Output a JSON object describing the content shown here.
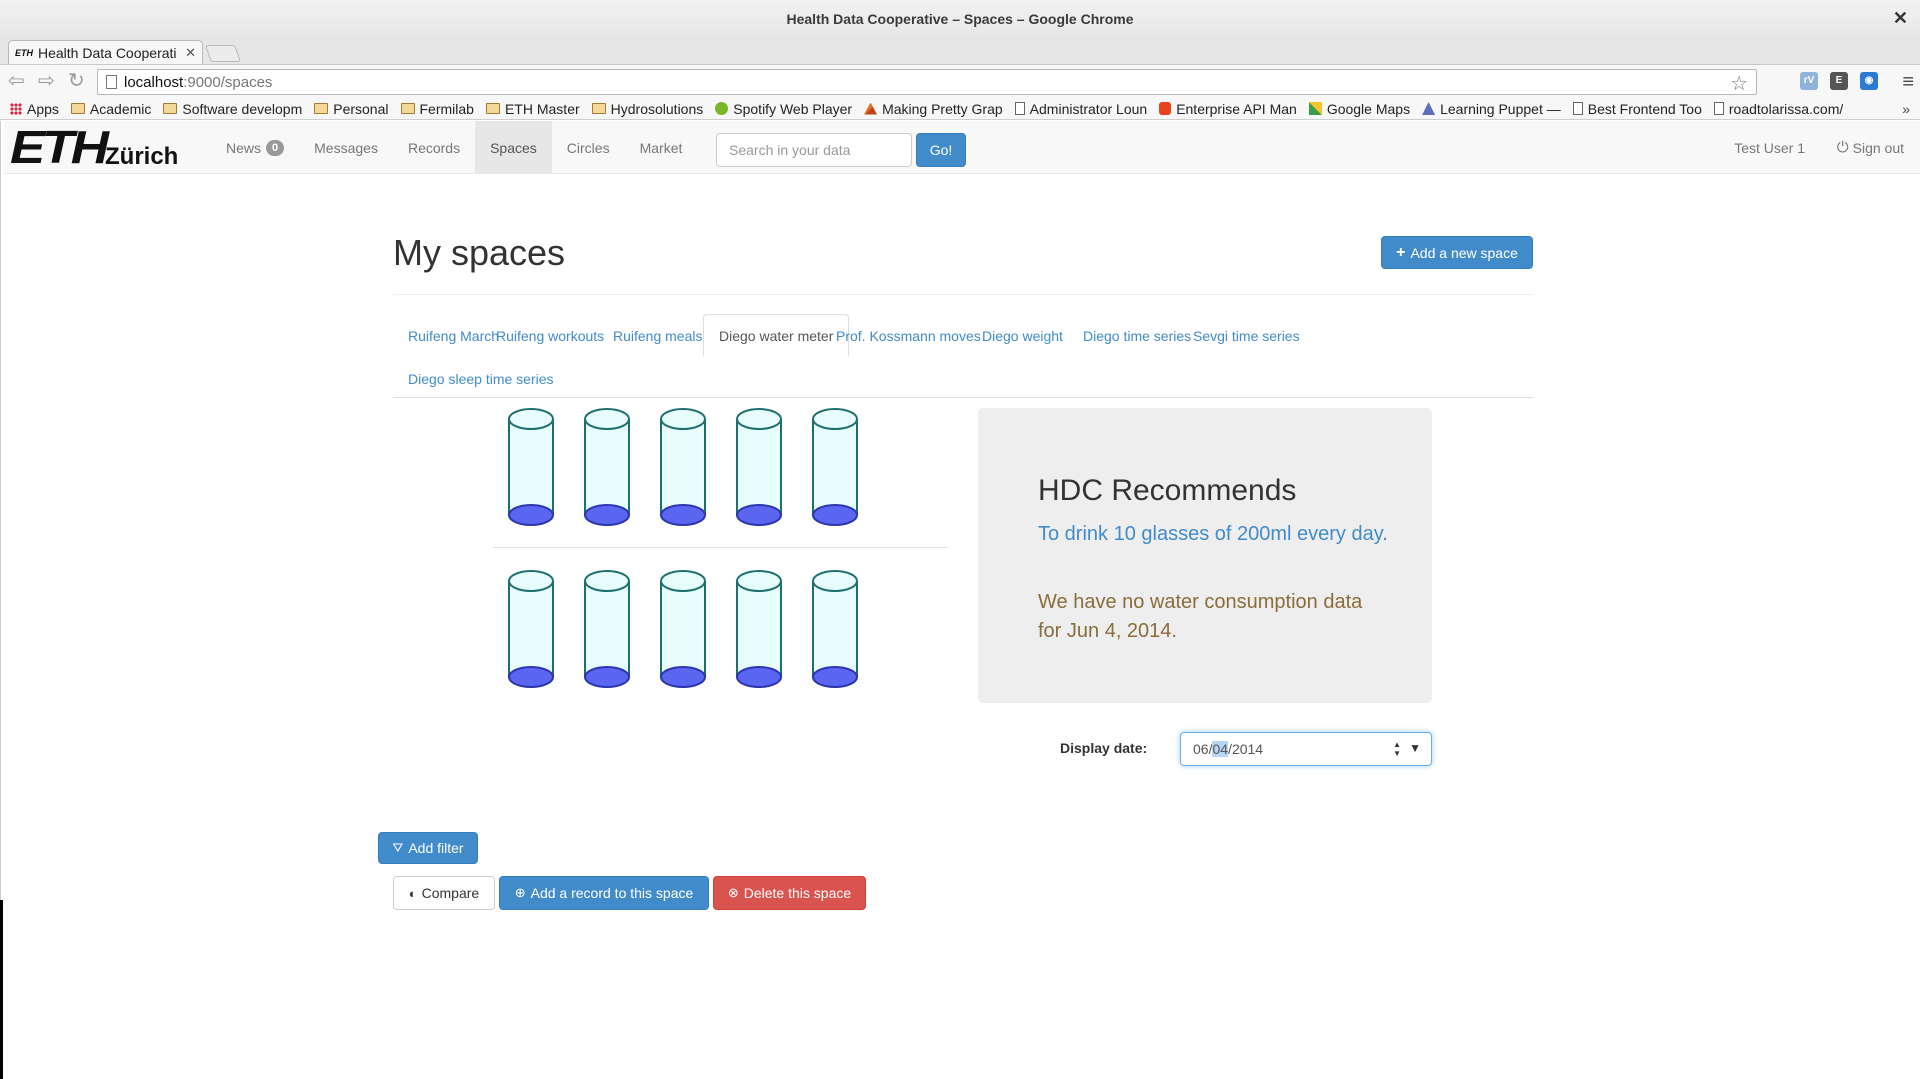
{
  "window": {
    "title": "Health Data Cooperative – Spaces – Google Chrome"
  },
  "browser_tab": {
    "favicon": "ETH",
    "title": "Health Data Cooperati"
  },
  "omnibox": {
    "host": "localhost",
    "path": ":9000/spaces"
  },
  "bookmarks": [
    {
      "label": "Apps",
      "icon": "apps-grid"
    },
    {
      "label": "Academic",
      "icon": "folder"
    },
    {
      "label": "Software developm",
      "icon": "folder"
    },
    {
      "label": "Personal",
      "icon": "folder"
    },
    {
      "label": "Fermilab",
      "icon": "folder"
    },
    {
      "label": "ETH Master",
      "icon": "folder"
    },
    {
      "label": "Hydrosolutions",
      "icon": "folder"
    },
    {
      "label": "Spotify Web Player",
      "icon": "spotify"
    },
    {
      "label": "Making Pretty Grap",
      "icon": "matlab"
    },
    {
      "label": "Administrator Loun",
      "icon": "page"
    },
    {
      "label": "Enterprise API Man",
      "icon": "red-o"
    },
    {
      "label": "Google Maps",
      "icon": "maps"
    },
    {
      "label": "Learning Puppet —",
      "icon": "puppet"
    },
    {
      "label": "Best Frontend Too",
      "icon": "page"
    },
    {
      "label": "roadtolarissa.com/",
      "icon": "page"
    }
  ],
  "bookmarks_more": "»",
  "navbar": {
    "logo_main": "ETH",
    "logo_sub": "Zürich",
    "items": [
      {
        "label": "News",
        "badge": "0"
      },
      {
        "label": "Messages"
      },
      {
        "label": "Records"
      },
      {
        "label": "Spaces",
        "active": true
      },
      {
        "label": "Circles"
      },
      {
        "label": "Market"
      }
    ],
    "search_placeholder": "Search in your data",
    "go_label": "Go!",
    "user": "Test User 1",
    "signout": "Sign out"
  },
  "page": {
    "heading": "My spaces",
    "add_space": "Add a new space",
    "tabs_row1": [
      "Ruifeng March",
      "Ruifeng workouts",
      "Ruifeng meals",
      "Diego water meter",
      "Prof. Kossmann moves",
      "Diego weight",
      "Diego time series",
      "Sevgi time series"
    ],
    "tabs_row2": [
      "Diego sleep time series"
    ],
    "active_tab": "Diego water meter"
  },
  "water_meter": {
    "glasses_per_row": 5,
    "rows": 2,
    "glasses_filled": 0,
    "glass_fill_color": "#e6fdfc",
    "glass_stroke_color": "#1f6f6f",
    "water_color": "#5a66f0"
  },
  "recommendation": {
    "title": "HDC Recommends",
    "text": "To drink 10 glasses of 200ml every day.",
    "no_data": "We have no water consumption data for Jun 4, 2014."
  },
  "date": {
    "label": "Display date:",
    "month": "06",
    "day": "04",
    "year": "2014"
  },
  "actions": {
    "add_filter": "Add filter",
    "compare": "Compare",
    "add_record": "Add a record to this space",
    "delete_space": "Delete this space"
  },
  "colors": {
    "primary": "#428bca",
    "danger": "#d9534f",
    "warning_text": "#8a6d3b"
  }
}
